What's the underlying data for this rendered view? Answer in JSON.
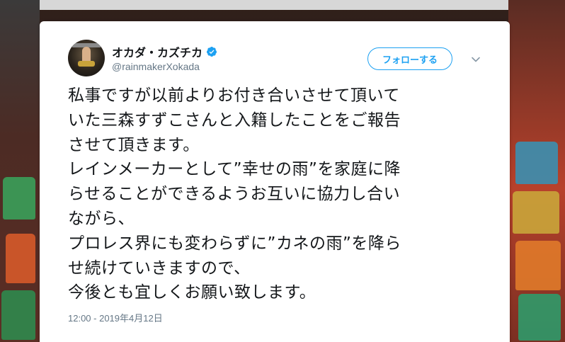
{
  "tweet": {
    "author": {
      "display_name": "オカダ・カズチカ",
      "handle": "@rainmakerXokada",
      "avatar_icon": "avatar-photo",
      "verified_icon": "verified-badge-icon"
    },
    "follow_label": "フォローする",
    "menu_icon": "chevron-down-icon",
    "text_lines": [
      "私事ですが以前よりお付き合いさせて頂いて",
      "いた三森すずこさんと入籍したことをご報告",
      "させて頂きます。",
      "レインメーカーとして”幸せの雨”を家庭に降",
      "らせることができるようお互いに協力し合い",
      "ながら、",
      "プロレス界にも変わらずに”カネの雨”を降ら",
      "せ続けていきますので、",
      "今後とも宜しくお願い致します。"
    ],
    "timestamp": "12:00 - 2019年4月12日"
  },
  "colors": {
    "accent": "#1da1f2",
    "text": "#14171a",
    "muted": "#657786"
  }
}
